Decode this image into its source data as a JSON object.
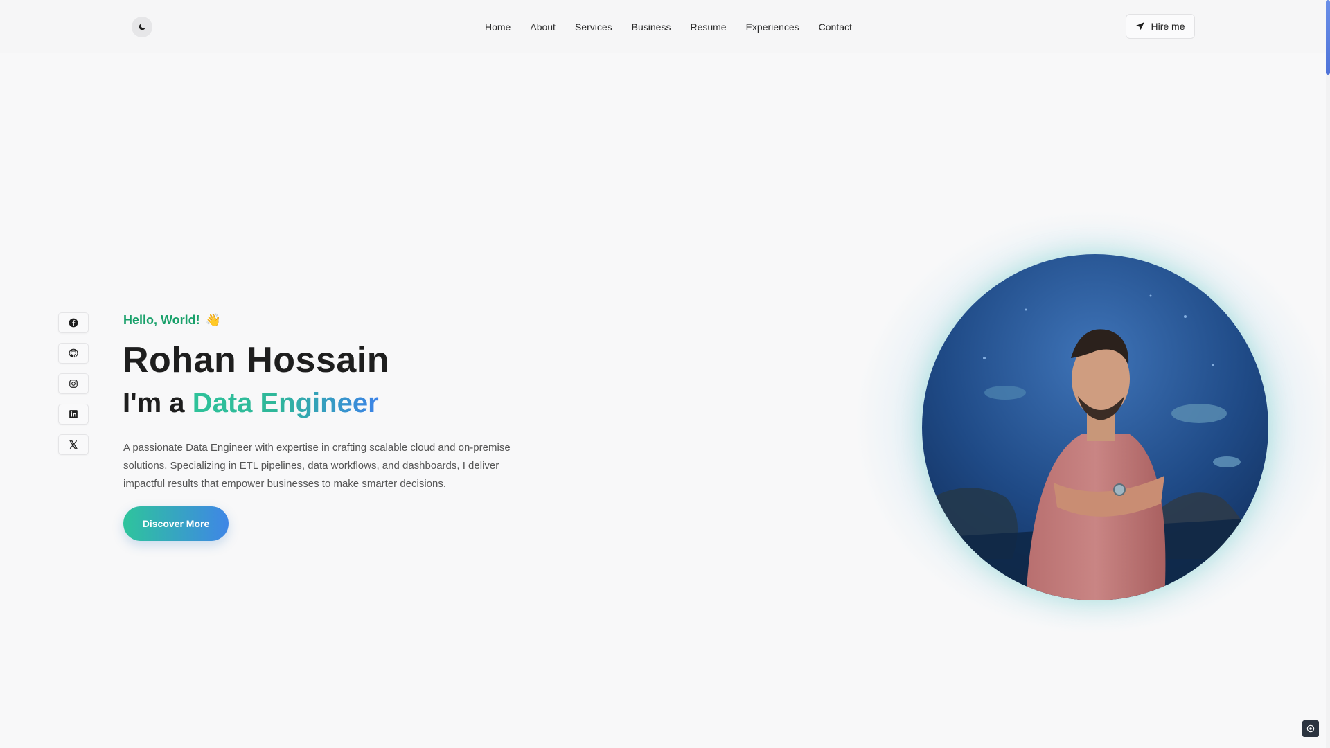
{
  "header": {
    "nav": [
      "Home",
      "About",
      "Services",
      "Business",
      "Resume",
      "Experiences",
      "Contact"
    ],
    "hire_label": "Hire me",
    "theme_icon": "moon-icon"
  },
  "socials": [
    "facebook-icon",
    "github-icon",
    "instagram-icon",
    "linkedin-icon",
    "x-icon"
  ],
  "hero": {
    "greeting": "Hello, World!",
    "greeting_emoji": "👋",
    "name": "Rohan Hossain",
    "role_prefix": "I'm a",
    "role": "Data Engineer",
    "description": "A passionate Data Engineer with expertise in crafting scalable cloud and on-premise solutions. Specializing in ETL pipelines, data workflows, and dashboards, I deliver impactful results that empower businesses to make smarter decisions.",
    "cta_label": "Discover More"
  },
  "colors": {
    "accent_green": "#18a06a",
    "gradient_start": "#2ec49c",
    "gradient_end": "#3f86e6",
    "background": "#f8f8f9"
  }
}
